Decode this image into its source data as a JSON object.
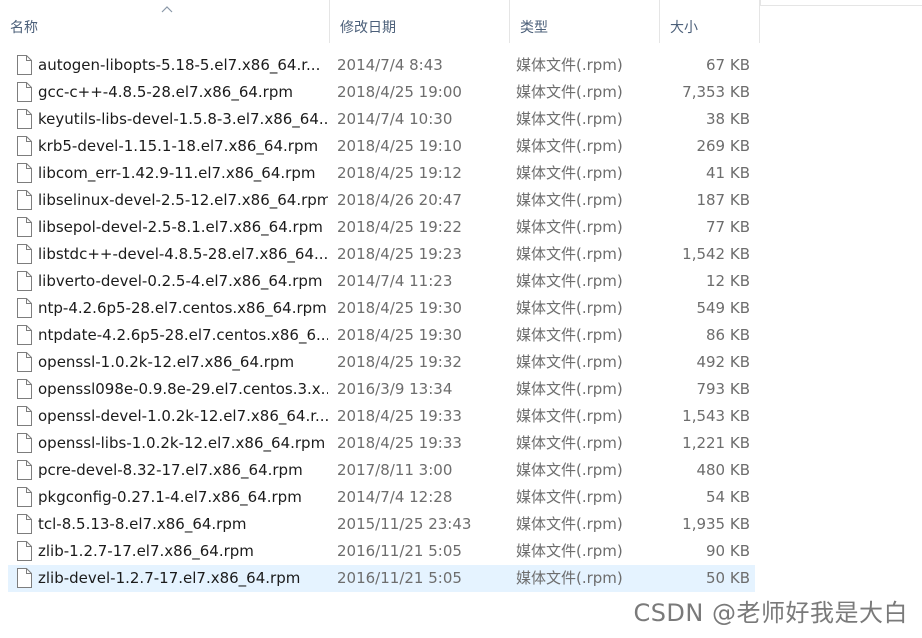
{
  "columns": {
    "name": "名称",
    "date": "修改日期",
    "type": "类型",
    "size": "大小"
  },
  "files": [
    {
      "name": "autogen-libopts-5.18-5.el7.x86_64.r...",
      "date": "2014/7/4 8:43",
      "type": "媒体文件(.rpm)",
      "size": "67 KB"
    },
    {
      "name": "gcc-c++-4.8.5-28.el7.x86_64.rpm",
      "date": "2018/4/25 19:00",
      "type": "媒体文件(.rpm)",
      "size": "7,353 KB"
    },
    {
      "name": "keyutils-libs-devel-1.5.8-3.el7.x86_64...",
      "date": "2014/7/4 10:30",
      "type": "媒体文件(.rpm)",
      "size": "38 KB"
    },
    {
      "name": "krb5-devel-1.15.1-18.el7.x86_64.rpm",
      "date": "2018/4/25 19:10",
      "type": "媒体文件(.rpm)",
      "size": "269 KB"
    },
    {
      "name": "libcom_err-1.42.9-11.el7.x86_64.rpm",
      "date": "2018/4/25 19:12",
      "type": "媒体文件(.rpm)",
      "size": "41 KB"
    },
    {
      "name": "libselinux-devel-2.5-12.el7.x86_64.rpm",
      "date": "2018/4/26 20:47",
      "type": "媒体文件(.rpm)",
      "size": "187 KB"
    },
    {
      "name": "libsepol-devel-2.5-8.1.el7.x86_64.rpm",
      "date": "2018/4/25 19:22",
      "type": "媒体文件(.rpm)",
      "size": "77 KB"
    },
    {
      "name": "libstdc++-devel-4.8.5-28.el7.x86_64....",
      "date": "2018/4/25 19:23",
      "type": "媒体文件(.rpm)",
      "size": "1,542 KB"
    },
    {
      "name": "libverto-devel-0.2.5-4.el7.x86_64.rpm",
      "date": "2014/7/4 11:23",
      "type": "媒体文件(.rpm)",
      "size": "12 KB"
    },
    {
      "name": "ntp-4.2.6p5-28.el7.centos.x86_64.rpm",
      "date": "2018/4/25 19:30",
      "type": "媒体文件(.rpm)",
      "size": "549 KB"
    },
    {
      "name": "ntpdate-4.2.6p5-28.el7.centos.x86_6...",
      "date": "2018/4/25 19:30",
      "type": "媒体文件(.rpm)",
      "size": "86 KB"
    },
    {
      "name": "openssl-1.0.2k-12.el7.x86_64.rpm",
      "date": "2018/4/25 19:32",
      "type": "媒体文件(.rpm)",
      "size": "492 KB"
    },
    {
      "name": "openssl098e-0.9.8e-29.el7.centos.3.x...",
      "date": "2016/3/9 13:34",
      "type": "媒体文件(.rpm)",
      "size": "793 KB"
    },
    {
      "name": "openssl-devel-1.0.2k-12.el7.x86_64.r...",
      "date": "2018/4/25 19:33",
      "type": "媒体文件(.rpm)",
      "size": "1,543 KB"
    },
    {
      "name": "openssl-libs-1.0.2k-12.el7.x86_64.rpm",
      "date": "2018/4/25 19:33",
      "type": "媒体文件(.rpm)",
      "size": "1,221 KB"
    },
    {
      "name": "pcre-devel-8.32-17.el7.x86_64.rpm",
      "date": "2017/8/11 3:00",
      "type": "媒体文件(.rpm)",
      "size": "480 KB"
    },
    {
      "name": "pkgconfig-0.27.1-4.el7.x86_64.rpm",
      "date": "2014/7/4 12:28",
      "type": "媒体文件(.rpm)",
      "size": "54 KB"
    },
    {
      "name": "tcl-8.5.13-8.el7.x86_64.rpm",
      "date": "2015/11/25 23:43",
      "type": "媒体文件(.rpm)",
      "size": "1,935 KB"
    },
    {
      "name": "zlib-1.2.7-17.el7.x86_64.rpm",
      "date": "2016/11/21 5:05",
      "type": "媒体文件(.rpm)",
      "size": "90 KB"
    },
    {
      "name": "zlib-devel-1.2.7-17.el7.x86_64.rpm",
      "date": "2016/11/21 5:05",
      "type": "媒体文件(.rpm)",
      "size": "50 KB",
      "selected": true
    }
  ],
  "icons": {
    "file": "file-icon",
    "sort": "sort-ascending-icon"
  },
  "colors": {
    "selection": "#e5f3ff",
    "header_text": "#4c607a"
  },
  "watermark": "CSDN @老师好我是大白"
}
